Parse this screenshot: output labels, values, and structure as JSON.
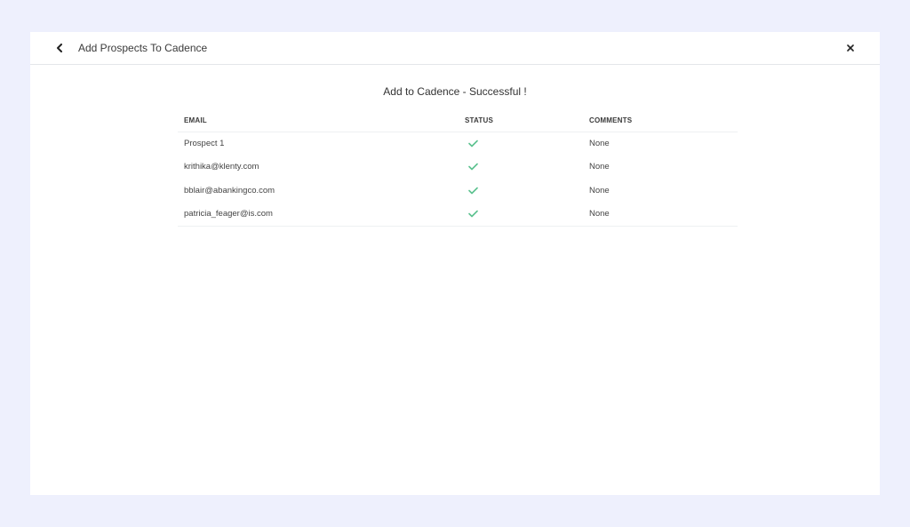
{
  "modal": {
    "title": "Add Prospects To Cadence",
    "back_icon": "chevron-left-icon",
    "close_icon": "close-icon"
  },
  "result": {
    "heading": "Add to Cadence - Successful !"
  },
  "table": {
    "columns": [
      "EMAIL",
      "STATUS",
      "COMMENTS"
    ],
    "rows": [
      {
        "email": "Prospect 1",
        "status": "success",
        "comments": "None"
      },
      {
        "email": "krithika@klenty.com",
        "status": "success",
        "comments": "None"
      },
      {
        "email": "bblair@abankingco.com",
        "status": "success",
        "comments": "None"
      },
      {
        "email": "patricia_feager@is.com",
        "status": "success",
        "comments": "None"
      }
    ]
  },
  "colors": {
    "background": "#eef0fd",
    "panel": "#ffffff",
    "success": "#5cc28f"
  }
}
